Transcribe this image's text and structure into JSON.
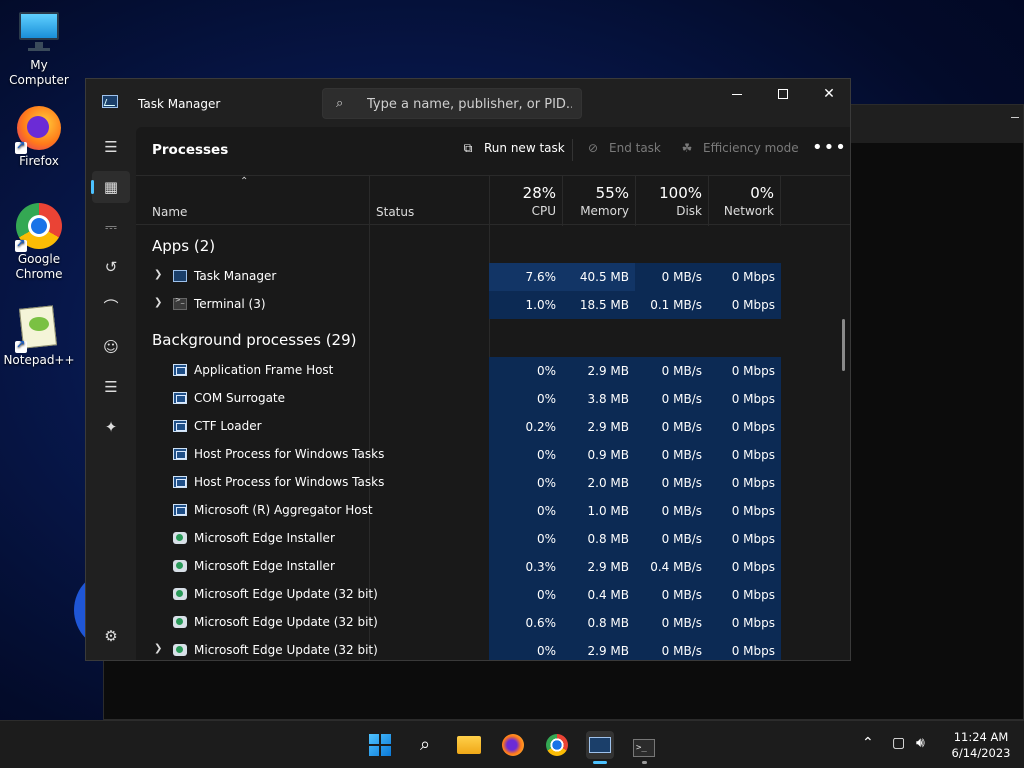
{
  "desktop": {
    "icons": [
      {
        "label": "My Computer"
      },
      {
        "label": "Firefox"
      },
      {
        "label": "Google Chrome"
      },
      {
        "label": "Notepad++"
      }
    ]
  },
  "task_manager": {
    "title": "Task Manager",
    "search_placeholder": "Type a name, publisher, or PID...",
    "page_title": "Processes",
    "commands": {
      "run_new_task": "Run new task",
      "end_task": "End task",
      "efficiency_mode": "Efficiency mode"
    },
    "columns": {
      "name": "Name",
      "status": "Status",
      "cpu": {
        "pct": "28%",
        "label": "CPU"
      },
      "memory": {
        "pct": "55%",
        "label": "Memory"
      },
      "disk": {
        "pct": "100%",
        "label": "Disk"
      },
      "network": {
        "pct": "0%",
        "label": "Network"
      }
    },
    "groups": {
      "apps": "Apps (2)",
      "background": "Background processes (29)"
    },
    "apps": [
      {
        "name": "Task Manager",
        "cpu": "7.6%",
        "memory": "40.5 MB",
        "disk": "0 MB/s",
        "network": "0 Mbps",
        "icon": "task-manager-icon"
      },
      {
        "name": "Terminal (3)",
        "cpu": "1.0%",
        "memory": "18.5 MB",
        "disk": "0.1 MB/s",
        "network": "0 Mbps",
        "icon": "terminal-icon"
      }
    ],
    "background": [
      {
        "name": "Application Frame Host",
        "cpu": "0%",
        "memory": "2.9 MB",
        "disk": "0 MB/s",
        "network": "0 Mbps"
      },
      {
        "name": "COM Surrogate",
        "cpu": "0%",
        "memory": "3.8 MB",
        "disk": "0 MB/s",
        "network": "0 Mbps"
      },
      {
        "name": "CTF Loader",
        "cpu": "0.2%",
        "memory": "2.9 MB",
        "disk": "0 MB/s",
        "network": "0 Mbps"
      },
      {
        "name": "Host Process for Windows Tasks",
        "cpu": "0%",
        "memory": "0.9 MB",
        "disk": "0 MB/s",
        "network": "0 Mbps"
      },
      {
        "name": "Host Process for Windows Tasks",
        "cpu": "0%",
        "memory": "2.0 MB",
        "disk": "0 MB/s",
        "network": "0 Mbps"
      },
      {
        "name": "Microsoft (R) Aggregator Host",
        "cpu": "0%",
        "memory": "1.0 MB",
        "disk": "0 MB/s",
        "network": "0 Mbps"
      },
      {
        "name": "Microsoft Edge Installer",
        "cpu": "0%",
        "memory": "0.8 MB",
        "disk": "0 MB/s",
        "network": "0 Mbps"
      },
      {
        "name": "Microsoft Edge Installer",
        "cpu": "0.3%",
        "memory": "2.9 MB",
        "disk": "0.4 MB/s",
        "network": "0 Mbps"
      },
      {
        "name": "Microsoft Edge Update (32 bit)",
        "cpu": "0%",
        "memory": "0.4 MB",
        "disk": "0 MB/s",
        "network": "0 Mbps"
      },
      {
        "name": "Microsoft Edge Update (32 bit)",
        "cpu": "0.6%",
        "memory": "0.8 MB",
        "disk": "0 MB/s",
        "network": "0 Mbps"
      },
      {
        "name": "Microsoft Edge Update (32 bit)",
        "cpu": "0%",
        "memory": "2.9 MB",
        "disk": "0 MB/s",
        "network": "0 Mbps"
      }
    ]
  },
  "taskbar": {
    "time": "11:24 AM",
    "date": "6/14/2023"
  },
  "colors": {
    "accent": "#4cc2ff",
    "heat_light": "#0c2a54",
    "heat_medium": "#123566"
  }
}
